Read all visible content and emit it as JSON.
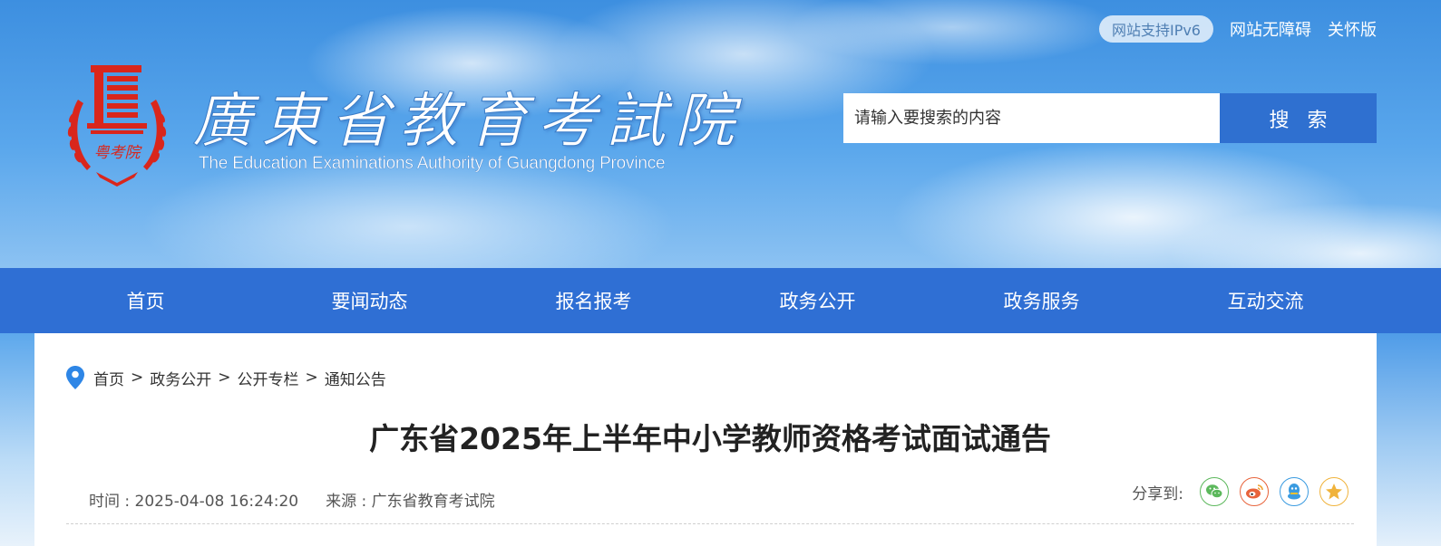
{
  "header": {
    "ipv6_badge": "网站支持IPv6",
    "links": [
      "网站无障碍",
      "关怀版"
    ],
    "logo_title": "廣東省教育考試院",
    "logo_subtitle": "The Education Examinations Authority of Guangdong Province",
    "logo_seal_text": "粤考院",
    "search": {
      "placeholder": "请输入要搜索的内容",
      "button_label": "搜索"
    }
  },
  "nav": {
    "items": [
      "首页",
      "要闻动态",
      "报名报考",
      "政务公开",
      "政务服务",
      "互动交流"
    ]
  },
  "breadcrumb": {
    "items": [
      "首页",
      "政务公开",
      "公开专栏",
      "通知公告"
    ],
    "separator": ">"
  },
  "article": {
    "title": "广东省2025年上半年中小学教师资格考试面试通告",
    "time": "时间 : 2025-04-08 16:24:20",
    "source": "来源 : 广东省教育考试院"
  },
  "share": {
    "label": "分享到:",
    "targets": [
      {
        "name": "wechat-icon",
        "color": "#5cb85c"
      },
      {
        "name": "weibo-icon",
        "color": "#e8643c"
      },
      {
        "name": "qq-icon",
        "color": "#3a9be0"
      },
      {
        "name": "qzone-icon",
        "color": "#f0b33c"
      }
    ]
  },
  "colors": {
    "nav_bg": "#2f6fd4",
    "search_button": "#2f70d0",
    "emblem_red": "#d9261c"
  }
}
